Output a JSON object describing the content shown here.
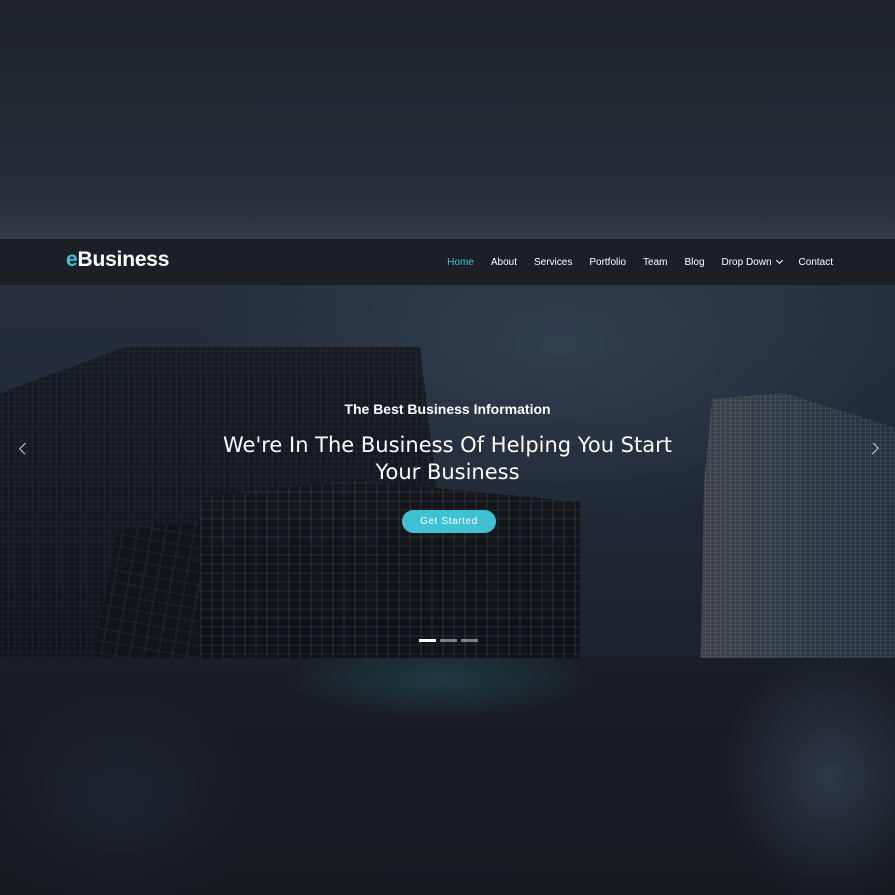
{
  "brand": {
    "logo_accent": "e",
    "logo_rest": "Business",
    "accent_color": "#3ec1d3"
  },
  "nav": {
    "items": [
      {
        "label": "Home",
        "active": true
      },
      {
        "label": "About"
      },
      {
        "label": "Services"
      },
      {
        "label": "Portfolio"
      },
      {
        "label": "Team"
      },
      {
        "label": "Blog"
      },
      {
        "label": "Drop Down",
        "has_dropdown": true,
        "icon": "chevron-down-icon"
      },
      {
        "label": "Contact"
      }
    ]
  },
  "hero": {
    "subtitle": "The Best Business Information",
    "headline": "We're In The Business Of Helping You Start Your Business",
    "cta_label": "Get Started",
    "prev_icon": "chevron-left-icon",
    "next_icon": "chevron-right-icon",
    "slides_total": 3,
    "active_slide": 1
  }
}
